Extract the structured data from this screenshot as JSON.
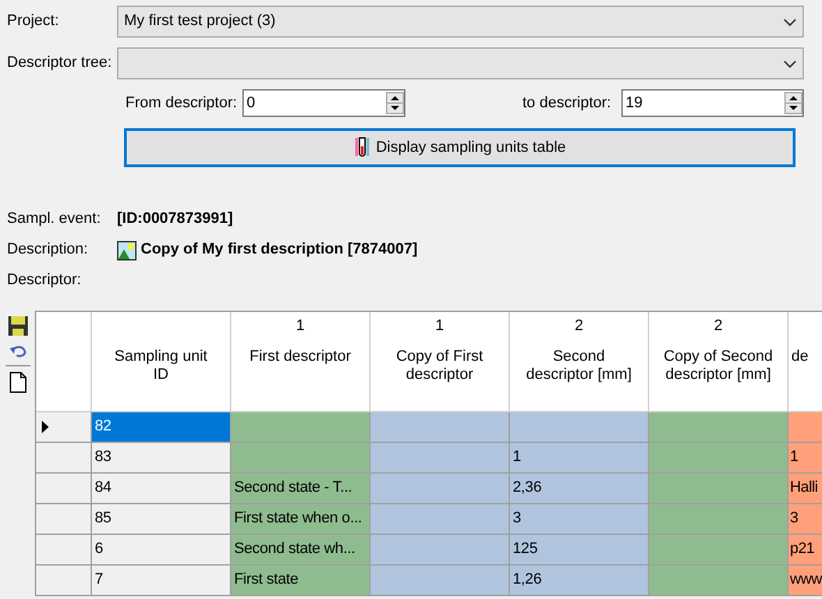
{
  "project": {
    "label": "Project:",
    "value": "My first test project (3)"
  },
  "descriptor_tree": {
    "label": "Descriptor tree:"
  },
  "from_descriptor": {
    "label": "From descriptor:",
    "value": "0"
  },
  "to_descriptor": {
    "label": "to descriptor:",
    "value": "19"
  },
  "display_button": {
    "label": "Display sampling units table"
  },
  "info": [
    {
      "kind": "plain",
      "label": "Sampl. event:",
      "value": "[ID:0007873991]"
    },
    {
      "kind": "image",
      "label": "Description:",
      "value": "Copy of My first description [7874007]"
    },
    {
      "kind": "plain",
      "label": "Descriptor:"
    }
  ],
  "grid": {
    "columns": [
      {
        "title": "Sampling unit ID"
      },
      {
        "number": "1",
        "title": "First descriptor",
        "color": "#8fbc8f"
      },
      {
        "number": "1",
        "title": "Copy of First descriptor",
        "color": "#b0c4de"
      },
      {
        "number": "2",
        "title": "Second descriptor [mm]",
        "color": "#b0c4de"
      },
      {
        "number": "2",
        "title": "Copy of Second descriptor [mm]",
        "color": "#8fbc8f"
      },
      {
        "title": "de",
        "color": "#ffa07a"
      }
    ],
    "rows": [
      {
        "selected": true,
        "cells": [
          "82",
          "",
          "",
          "",
          "",
          ""
        ]
      },
      {
        "selected": false,
        "cells": [
          "83",
          "",
          "",
          "1",
          "",
          "1"
        ]
      },
      {
        "selected": false,
        "cells": [
          "84",
          "Second state - T...",
          "",
          "2,36",
          "",
          "Halli"
        ]
      },
      {
        "selected": false,
        "cells": [
          "85",
          "First state when o...",
          "",
          "3",
          "",
          "3"
        ]
      },
      {
        "selected": false,
        "cells": [
          "6",
          "Second state wh...",
          "",
          "125",
          "",
          "p21"
        ]
      },
      {
        "selected": false,
        "cells": [
          "7",
          "First state",
          "",
          "1,26",
          "",
          "www"
        ]
      }
    ]
  }
}
